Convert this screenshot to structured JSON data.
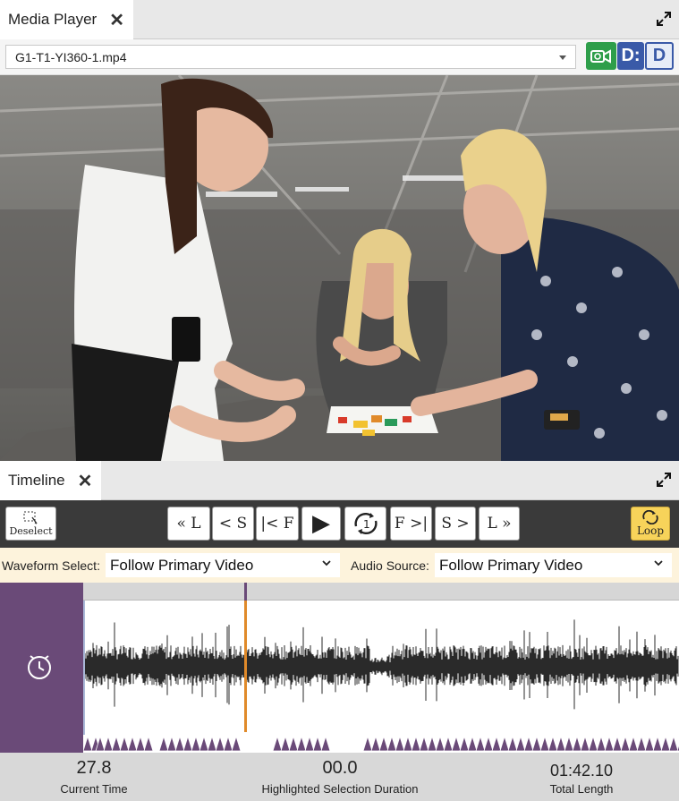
{
  "media_player": {
    "tab_title": "Media Player",
    "file": "G1-T1-YI360-1.mp4",
    "buttons": [
      {
        "name": "follow-video-icon",
        "label": ""
      },
      {
        "name": "d-button-1",
        "label": "D:"
      },
      {
        "name": "d-button-2",
        "label": "D"
      }
    ]
  },
  "timeline": {
    "tab_title": "Timeline",
    "deselect_label": "Deselect",
    "loop_label": "Loop",
    "controls": [
      {
        "name": "back-l-button",
        "label": "« L"
      },
      {
        "name": "back-s-button",
        "label": "< S"
      },
      {
        "name": "back-f-button",
        "label": "|< F"
      },
      {
        "name": "play-button",
        "label": "▶"
      },
      {
        "name": "loop-one-button",
        "label": "1"
      },
      {
        "name": "forward-f-button",
        "label": "F >|"
      },
      {
        "name": "forward-s-button",
        "label": "S >"
      },
      {
        "name": "forward-l-button",
        "label": "L »"
      }
    ],
    "waveform_select_label": "Waveform Select:",
    "waveform_select_value": "Follow Primary Video",
    "audio_source_label": "Audio Source:",
    "audio_source_value": "Follow Primary Video",
    "current_time": "27.8",
    "current_time_label": "Current Time",
    "highlight_duration": "00.0",
    "highlight_duration_label": "Highlighted Selection Duration",
    "total_length": "01:42.10",
    "total_length_label": "Total Length"
  },
  "colors": {
    "accent_purple": "#6a4a78",
    "playhead": "#e08a2a",
    "loop_active": "#f7d35a",
    "green_button": "#2e9e4a",
    "blue_button": "#3a5aa8"
  }
}
